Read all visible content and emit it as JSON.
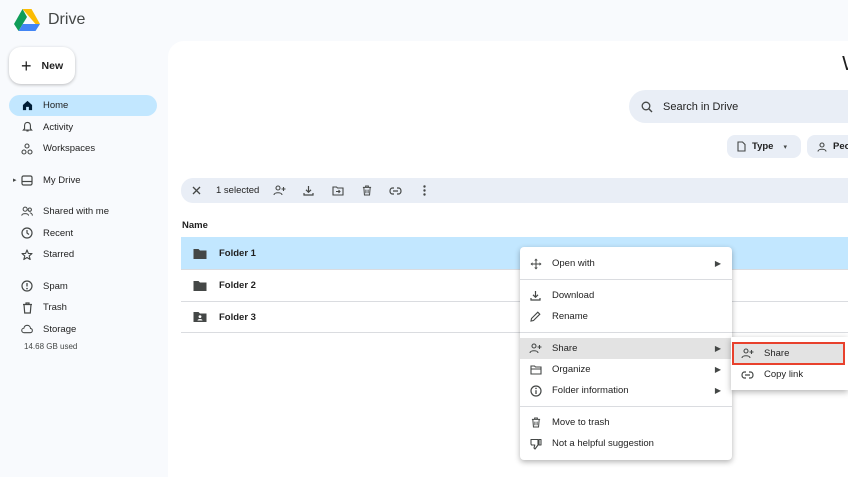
{
  "app": {
    "name": "Drive"
  },
  "new_button": {
    "label": "New"
  },
  "sidebar": {
    "items": [
      {
        "label": "Home",
        "icon": "home-icon",
        "active": true
      },
      {
        "label": "Activity",
        "icon": "bell-icon"
      },
      {
        "label": "Workspaces",
        "icon": "workspaces-icon"
      },
      {
        "label": "My Drive",
        "icon": "my-drive-icon"
      },
      {
        "label": "Shared with me",
        "icon": "people-icon"
      },
      {
        "label": "Recent",
        "icon": "clock-icon"
      },
      {
        "label": "Starred",
        "icon": "star-icon"
      },
      {
        "label": "Spam",
        "icon": "spam-icon"
      },
      {
        "label": "Trash",
        "icon": "trash-icon"
      },
      {
        "label": "Storage",
        "icon": "cloud-icon"
      }
    ],
    "storage_used": "14.68 GB used"
  },
  "main": {
    "heading_fragment": "W",
    "search": {
      "placeholder": "Search in Drive"
    },
    "filters": {
      "type": "Type",
      "people": "Peo"
    },
    "selection": {
      "count_label": "1 selected"
    },
    "column_name": "Name",
    "files": [
      {
        "name": "Folder 1",
        "selected": true,
        "icon": "folder-icon"
      },
      {
        "name": "Folder 2",
        "selected": false,
        "icon": "folder-icon"
      },
      {
        "name": "Folder 3",
        "selected": false,
        "icon": "shared-folder-icon"
      }
    ]
  },
  "context_menu": {
    "open_with": "Open with",
    "download": "Download",
    "rename": "Rename",
    "share": "Share",
    "organize": "Organize",
    "folder_information": "Folder information",
    "move_to_trash": "Move to trash",
    "not_helpful": "Not a helpful suggestion"
  },
  "share_submenu": {
    "share": "Share",
    "copy_link": "Copy link"
  },
  "colors": {
    "selected": "#c2e7ff",
    "highlight_box": "#e8412d",
    "surface": "#e9eef6"
  }
}
